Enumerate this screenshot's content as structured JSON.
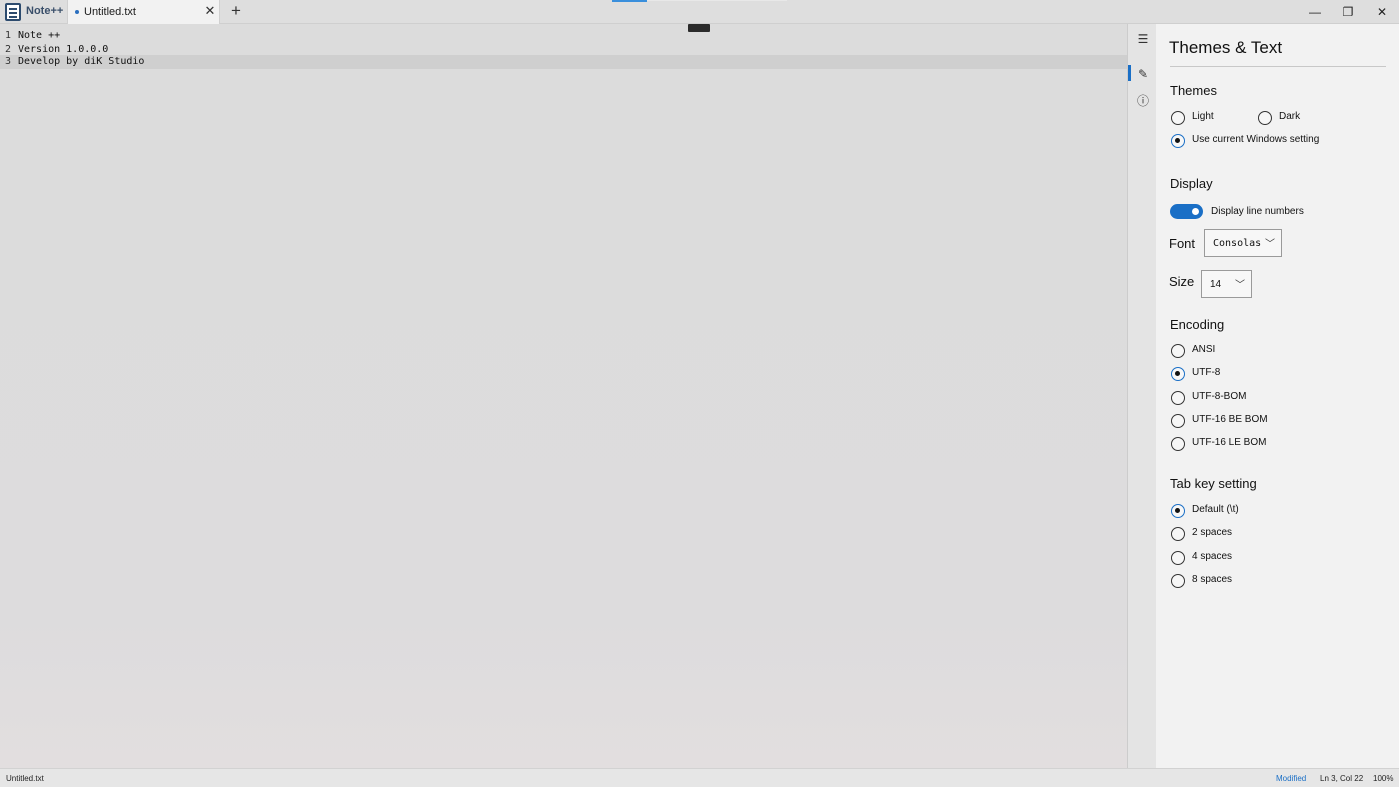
{
  "app": {
    "name": "Note++"
  },
  "tabs": [
    {
      "label": "Untitled.txt",
      "modified": true
    }
  ],
  "editor": {
    "lines": [
      {
        "number": "1",
        "text": "Note ++"
      },
      {
        "number": "2",
        "text": "Version 1.0.0.0"
      },
      {
        "number": "3",
        "text": "Develop by diK Studio"
      }
    ]
  },
  "settings": {
    "title": "Themes & Text",
    "themes": {
      "heading": "Themes",
      "options": [
        "Light",
        "Dark",
        "Use current Windows setting"
      ],
      "selected": "Use current Windows setting"
    },
    "display": {
      "heading": "Display",
      "line_numbers_label": "Display line numbers",
      "line_numbers_on": true,
      "font_label": "Font",
      "font_value": "Consolas",
      "size_label": "Size",
      "size_value": "14"
    },
    "encoding": {
      "heading": "Encoding",
      "options": [
        "ANSI",
        "UTF-8",
        "UTF-8-BOM",
        "UTF-16 BE BOM",
        "UTF-16 LE BOM"
      ],
      "selected": "UTF-8"
    },
    "tab_key": {
      "heading": "Tab key setting",
      "options": [
        "Default (\\t)",
        "2 spaces",
        "4 spaces",
        "8 spaces"
      ],
      "selected": "Default (\\t)"
    }
  },
  "statusbar": {
    "file": "Untitled.txt",
    "state": "Modified",
    "position": "Ln 3, Col 22",
    "zoom": "100%"
  },
  "colors": {
    "accent": "#1a6fc6"
  }
}
